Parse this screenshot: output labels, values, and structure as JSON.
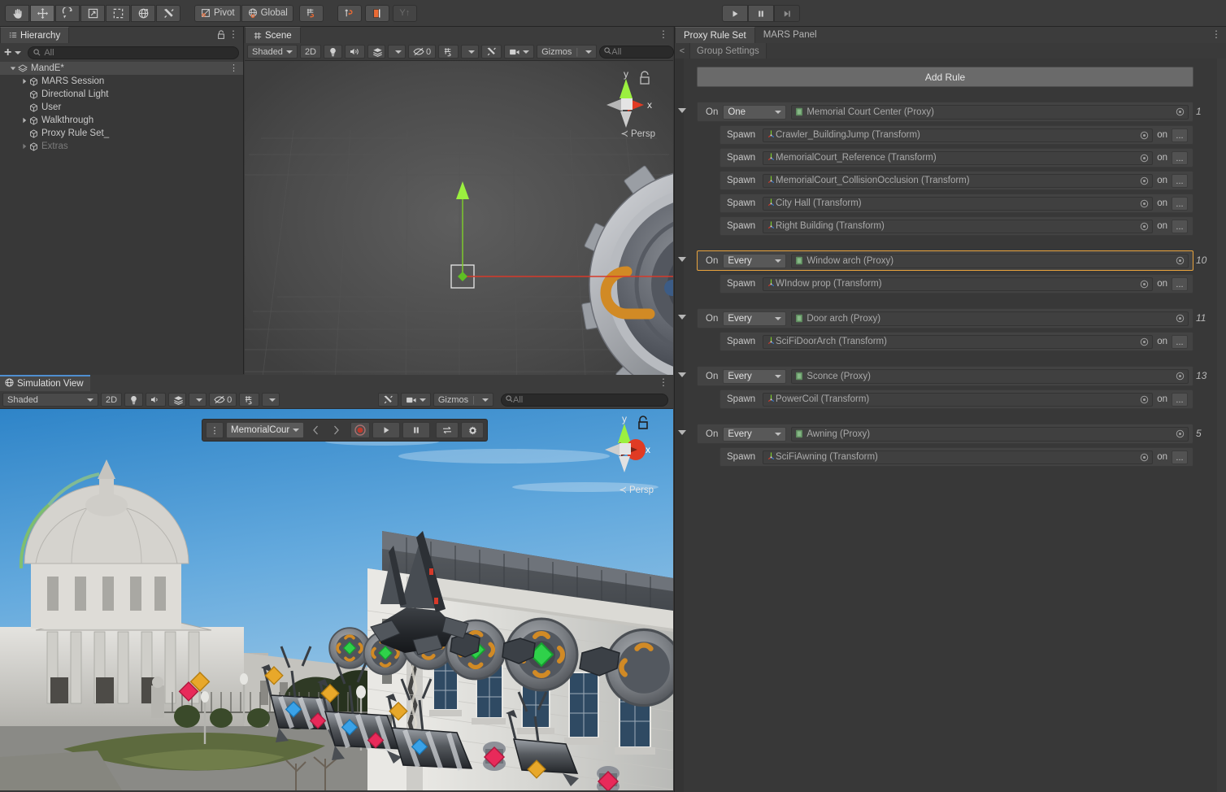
{
  "toolbar": {
    "tools": [
      {
        "name": "hand-tool",
        "icon": "hand",
        "active": false
      },
      {
        "name": "move-tool",
        "icon": "move",
        "active": true
      },
      {
        "name": "rotate-tool",
        "icon": "rotate",
        "active": false
      },
      {
        "name": "scale-tool",
        "icon": "scale",
        "active": false
      },
      {
        "name": "rect-tool",
        "icon": "rect",
        "active": false
      },
      {
        "name": "transform-tool",
        "icon": "transform",
        "active": false
      },
      {
        "name": "custom-tool",
        "icon": "wrench",
        "active": false
      }
    ],
    "pivot_label": "Pivot",
    "handle_label": "Global",
    "grid_label": "grid-snap",
    "mars_sim_label": "mars-simulate",
    "mars_env_label": "mars-environment",
    "y_up_label": "Y↑",
    "play_label": "play",
    "pause_label": "pause",
    "step_label": "step"
  },
  "hierarchy": {
    "tab": "Hierarchy",
    "create_label": "+",
    "search_placeholder": "All",
    "items": [
      {
        "label": "MandE*",
        "depth": 0,
        "arrow": "down",
        "icon": "scene-icon",
        "selected": true,
        "dim": false,
        "menu": true
      },
      {
        "label": "MARS Session",
        "depth": 1,
        "arrow": "right",
        "icon": "gameobject-icon",
        "selected": false,
        "dim": false
      },
      {
        "label": "Directional Light",
        "depth": 1,
        "arrow": "none",
        "icon": "gameobject-icon",
        "selected": false,
        "dim": false
      },
      {
        "label": "User",
        "depth": 1,
        "arrow": "none",
        "icon": "gameobject-icon",
        "selected": false,
        "dim": false
      },
      {
        "label": "Walkthrough",
        "depth": 1,
        "arrow": "right",
        "icon": "gameobject-icon",
        "selected": false,
        "dim": false
      },
      {
        "label": "Proxy Rule Set_",
        "depth": 1,
        "arrow": "none",
        "icon": "gameobject-icon",
        "selected": false,
        "dim": false
      },
      {
        "label": "Extras",
        "depth": 1,
        "arrow": "right",
        "icon": "gameobject-icon",
        "selected": false,
        "dim": true
      }
    ]
  },
  "scene": {
    "tab": "Scene",
    "draw_mode": "Shaded",
    "mode_2d": "2D",
    "audio_label": "audio",
    "fx_label": "effects",
    "hidden_count": "0",
    "grid_label": "grid",
    "gizmos_label": "Gizmos",
    "search_placeholder": "All",
    "projection_label": "Persp",
    "axis_x": "x",
    "axis_y": "y"
  },
  "simulation": {
    "tab": "Simulation View",
    "draw_mode": "Shaded",
    "mode_2d": "2D",
    "hidden_count": "0",
    "gizmos_label": "Gizmos",
    "search_placeholder": "All",
    "projection_label": "Persp",
    "axis_x": "x",
    "axis_y": "y",
    "controls": {
      "menu_label": "more-options",
      "environment": "MemorialCour",
      "prev_label": "prev-environment",
      "next_label": "next-environment",
      "record_label": "record",
      "play_label": "play-simulation",
      "pause_label": "pause-simulation",
      "loop_label": "loop",
      "settings_label": "settings"
    }
  },
  "right_panel": {
    "tabs": [
      {
        "label": "Proxy Rule Set",
        "active": true
      },
      {
        "label": "MARS Panel",
        "active": false
      }
    ],
    "breadcrumb_back": "<",
    "breadcrumb": "Group Settings",
    "add_rule_label": "Add Rule",
    "on_label": "On",
    "spawn_label": "Spawn",
    "on_small_label": "on",
    "ellipsis_label": "...",
    "rules": [
      {
        "condition": "One",
        "proxy": "Memorial Court Center (Proxy)",
        "count": "1",
        "selected": false,
        "spawns": [
          "Crawler_BuildingJump (Transform)",
          "MemorialCourt_Reference (Transform)",
          "MemorialCourt_CollisionOcclusion (Transform)",
          "City Hall (Transform)",
          "Right Building (Transform)"
        ]
      },
      {
        "condition": "Every",
        "proxy": "Window arch (Proxy)",
        "count": "10",
        "selected": true,
        "spawns": [
          "WIndow prop (Transform)"
        ]
      },
      {
        "condition": "Every",
        "proxy": "Door arch (Proxy)",
        "count": "11",
        "selected": false,
        "spawns": [
          "SciFiDoorArch (Transform)"
        ]
      },
      {
        "condition": "Every",
        "proxy": "Sconce (Proxy)",
        "count": "13",
        "selected": false,
        "spawns": [
          "PowerCoil (Transform)"
        ]
      },
      {
        "condition": "Every",
        "proxy": "Awning (Proxy)",
        "count": "5",
        "selected": false,
        "spawns": [
          "SciFiAwning (Transform)"
        ]
      }
    ]
  },
  "colors": {
    "accent_orange": "#e8a33d",
    "tool_orange": "#ea6a34",
    "panel_bg": "#383838",
    "toolbar_bg": "#3c3c3c",
    "selection": "#4a4a4a",
    "sim_tab_accent": "#4f8fd0",
    "axis_x": "#d63a2a",
    "axis_y": "#7fd02a",
    "axis_z": "#3a7fd6"
  }
}
